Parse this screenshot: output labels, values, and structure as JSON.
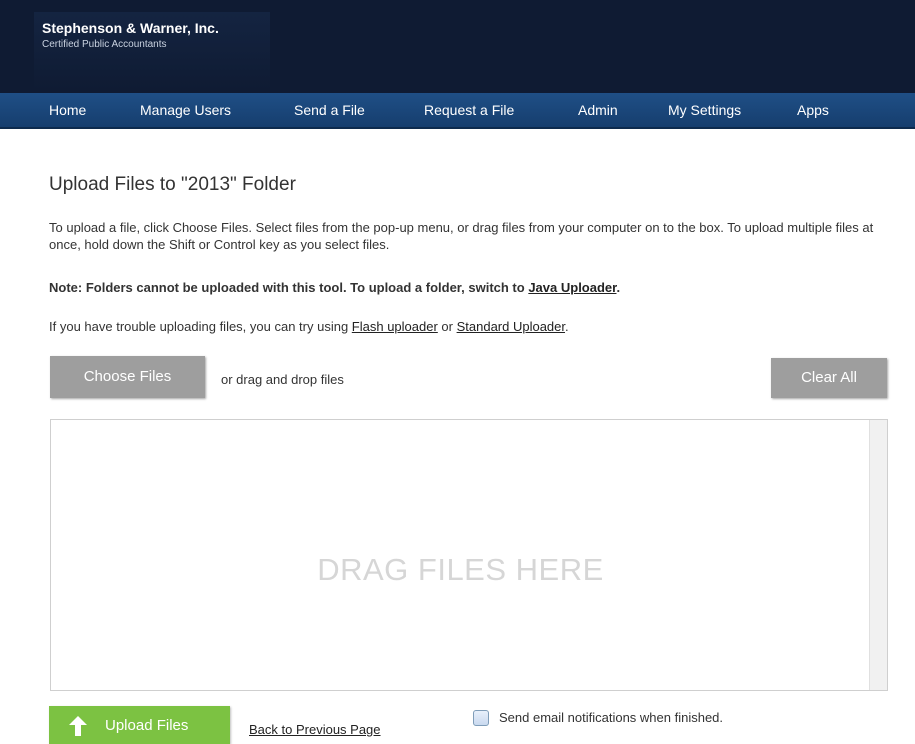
{
  "header": {
    "company": "Stephenson & Warner, Inc.",
    "tagline": "Certified Public Accountants"
  },
  "nav": {
    "items": [
      "Home",
      "Manage Users",
      "Send a File",
      "Request a File",
      "Admin",
      "My Settings",
      "Apps"
    ]
  },
  "main": {
    "title": "Upload Files to \"2013\" Folder",
    "instructions": "To upload a file, click Choose Files. Select files from the pop-up menu, or drag files from your computer on to the box. To upload multiple files at once, hold down the Shift or Control key as you select files.",
    "note_prefix": "Note: Folders cannot be uploaded with this tool. To upload a folder, switch to ",
    "note_link": "Java Uploader",
    "note_suffix": ".",
    "trouble_prefix": "If you have trouble uploading files, you can try using ",
    "trouble_link1": "Flash uploader",
    "trouble_mid": " or ",
    "trouble_link2": "Standard Uploader",
    "trouble_suffix": ".",
    "choose_label": "Choose Files",
    "drag_hint": "or drag and drop files",
    "clear_label": "Clear All",
    "dropzone_text": "DRAG FILES HERE",
    "upload_label": "Upload Files",
    "back_label": "Back to Previous Page",
    "notify_label": "Send email notifications when finished.",
    "notify_checked": false
  },
  "colors": {
    "header_bg": "#0f1b33",
    "nav_bg": "#1f4f86",
    "button_gray": "#9e9e9e",
    "upload_green": "#7cc242"
  },
  "icons": {
    "upload": "up-arrow-icon"
  }
}
